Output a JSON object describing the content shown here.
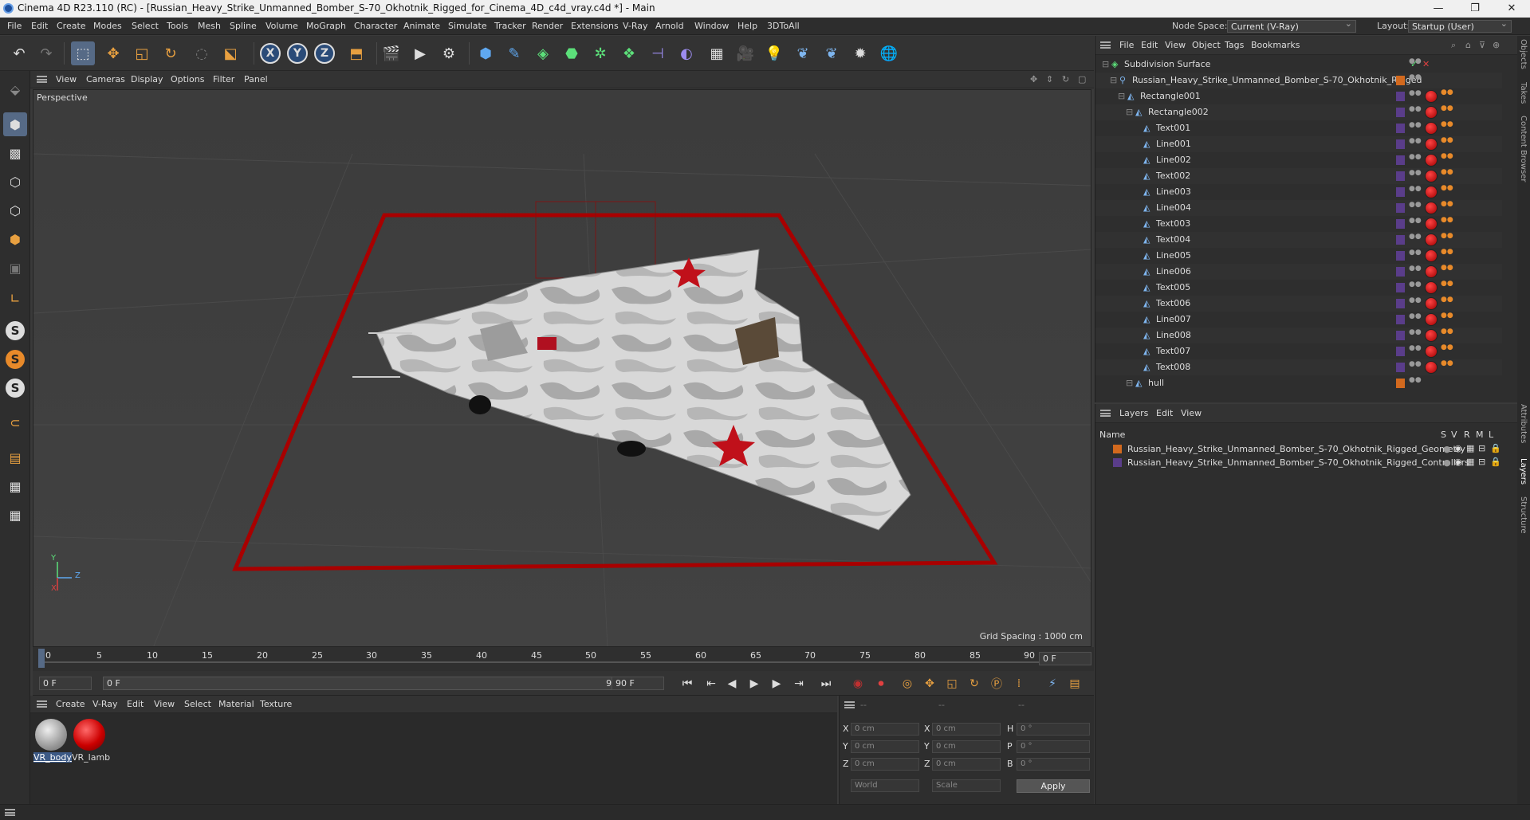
{
  "window": {
    "title": "Cinema 4D R23.110 (RC) - [Russian_Heavy_Strike_Unmanned_Bomber_S-70_Okhotnik_Rigged_for_Cinema_4D_c4d_vray.c4d *] - Main"
  },
  "menubar": {
    "items": [
      "File",
      "Edit",
      "Create",
      "Modes",
      "Select",
      "Tools",
      "Mesh",
      "Spline",
      "Volume",
      "MoGraph",
      "Character",
      "Animate",
      "Simulate",
      "Tracker",
      "Render",
      "Extensions",
      "V-Ray",
      "Arnold",
      "Window",
      "Help",
      "3DToAll"
    ],
    "node_space_label": "Node Space:",
    "node_space_value": "Current (V-Ray)",
    "layout_label": "Layout:",
    "layout_value": "Startup (User)"
  },
  "viewport": {
    "menu": [
      "View",
      "Cameras",
      "Display",
      "Options",
      "Filter",
      "Panel"
    ],
    "label": "Perspective",
    "grid_spacing": "Grid Spacing : 1000 cm",
    "axis": {
      "y": "Y",
      "z": "Z",
      "x": "X"
    }
  },
  "timeline": {
    "ticks": [
      "0",
      "5",
      "10",
      "15",
      "20",
      "25",
      "30",
      "35",
      "40",
      "45",
      "50",
      "55",
      "60",
      "65",
      "70",
      "75",
      "80",
      "85",
      "90"
    ],
    "current": "0 F"
  },
  "playbar": {
    "start": "0 F",
    "slider_left": "0 F",
    "slider_right": "90 F",
    "end": "90 F"
  },
  "materials": {
    "menu": [
      "Create",
      "V-Ray",
      "Edit",
      "View",
      "Select",
      "Material",
      "Texture"
    ],
    "items": [
      {
        "name": "VR_body"
      },
      {
        "name": "VR_lamb"
      }
    ]
  },
  "coords": {
    "header": [
      "--",
      "--",
      "--"
    ],
    "rows": [
      {
        "a": "X",
        "av": "0 cm",
        "b": "X",
        "bv": "0 cm",
        "c": "H",
        "cv": "0 °"
      },
      {
        "a": "Y",
        "av": "0 cm",
        "b": "Y",
        "bv": "0 cm",
        "c": "P",
        "cv": "0 °"
      },
      {
        "a": "Z",
        "av": "0 cm",
        "b": "Z",
        "bv": "0 cm",
        "c": "B",
        "cv": "0 °"
      }
    ],
    "mode1": "World",
    "mode2": "Scale",
    "apply": "Apply"
  },
  "objects": {
    "menu": [
      "File",
      "Edit",
      "View",
      "Object",
      "Tags",
      "Bookmarks"
    ],
    "rows": [
      {
        "name": "Subdivision Surface",
        "indent": 0
      },
      {
        "name": "Russian_Heavy_Strike_Unmanned_Bomber_S-70_Okhotnik_Rigged",
        "indent": 1
      },
      {
        "name": "Rectangle001",
        "indent": 2
      },
      {
        "name": "Rectangle002",
        "indent": 3
      },
      {
        "name": "Text001",
        "indent": 4
      },
      {
        "name": "Line001",
        "indent": 4
      },
      {
        "name": "Line002",
        "indent": 4
      },
      {
        "name": "Text002",
        "indent": 4
      },
      {
        "name": "Line003",
        "indent": 4
      },
      {
        "name": "Line004",
        "indent": 4
      },
      {
        "name": "Text003",
        "indent": 4
      },
      {
        "name": "Text004",
        "indent": 4
      },
      {
        "name": "Line005",
        "indent": 4
      },
      {
        "name": "Line006",
        "indent": 4
      },
      {
        "name": "Text005",
        "indent": 4
      },
      {
        "name": "Text006",
        "indent": 4
      },
      {
        "name": "Line007",
        "indent": 4
      },
      {
        "name": "Line008",
        "indent": 4
      },
      {
        "name": "Text007",
        "indent": 4
      },
      {
        "name": "Text008",
        "indent": 4
      },
      {
        "name": "hull",
        "indent": 3
      }
    ]
  },
  "layers": {
    "menu": [
      "Layers",
      "Edit",
      "View"
    ],
    "col_name": "Name",
    "cols": [
      "S",
      "V",
      "R",
      "M",
      "L"
    ],
    "rows": [
      {
        "name": "Russian_Heavy_Strike_Unmanned_Bomber_S-70_Okhotnik_Rigged_Geometry",
        "color": "#d2691e"
      },
      {
        "name": "Russian_Heavy_Strike_Unmanned_Bomber_S-70_Okhotnik_Rigged_Controllers",
        "color": "#5a3d8a"
      }
    ]
  },
  "right_tabs": [
    "Objects",
    "Takes",
    "Content Browser",
    "Attributes",
    "Layers",
    "Structure"
  ]
}
